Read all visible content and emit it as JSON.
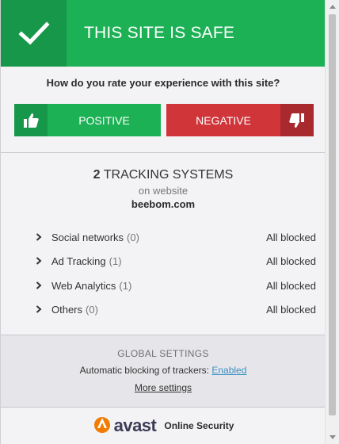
{
  "header": {
    "title": "THIS SITE IS SAFE",
    "icon": "checkmark-icon",
    "color": "#1db155"
  },
  "rating": {
    "question": "How do you rate your experience with this site?",
    "positive_label": "POSITIVE",
    "negative_label": "NEGATIVE",
    "positive_color": "#1db155",
    "negative_color": "#d0353a"
  },
  "tracking": {
    "count": "2",
    "count_label": "TRACKING SYSTEMS",
    "subtitle": "on website",
    "site": "beebom.com",
    "items": [
      {
        "name": "Social networks",
        "count": "(0)",
        "status": "All blocked"
      },
      {
        "name": "Ad Tracking",
        "count": "(1)",
        "status": "All blocked"
      },
      {
        "name": "Web Analytics",
        "count": "(1)",
        "status": "All blocked"
      },
      {
        "name": "Others",
        "count": "(0)",
        "status": "All blocked"
      }
    ]
  },
  "global_settings": {
    "title": "GLOBAL SETTINGS",
    "auto_label": "Automatic blocking of trackers:",
    "auto_value": "Enabled",
    "more_link": "More settings"
  },
  "footer": {
    "brand": "avast",
    "tagline": "Online Security",
    "brand_color": "#f27c00"
  }
}
